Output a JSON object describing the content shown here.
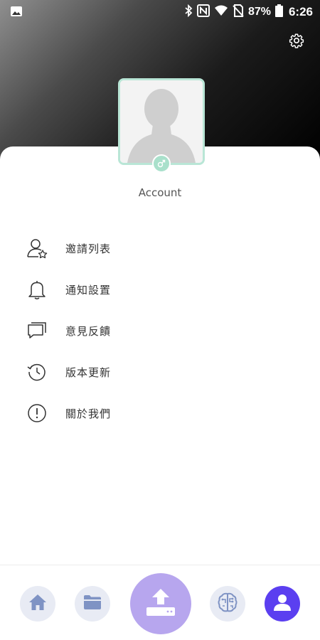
{
  "status_bar": {
    "battery_percent": "87%",
    "time": "6:26",
    "icons": [
      "image-icon",
      "bluetooth-icon",
      "nfc-icon",
      "wifi-icon",
      "no-sim-icon",
      "battery-icon"
    ]
  },
  "header": {
    "settings_icon": "gear-icon"
  },
  "profile": {
    "account_name": "Account",
    "gender_icon": "male-icon"
  },
  "menu": {
    "items": [
      {
        "label": "邀請列表",
        "icon": "user-invite-icon"
      },
      {
        "label": "通知設置",
        "icon": "bell-icon"
      },
      {
        "label": "意見反饋",
        "icon": "chat-icon"
      },
      {
        "label": "版本更新",
        "icon": "history-icon"
      },
      {
        "label": "關於我們",
        "icon": "info-icon"
      }
    ]
  },
  "bottom_nav": {
    "items": [
      {
        "icon": "home-icon",
        "active": false
      },
      {
        "icon": "folder-icon",
        "active": false
      },
      {
        "icon": "upload-icon",
        "active": false
      },
      {
        "icon": "brain-icon",
        "active": false
      },
      {
        "icon": "person-icon",
        "active": true
      }
    ]
  },
  "colors": {
    "accent": "#5b3ff0",
    "upload_bg": "#b7a6ee",
    "nav_inactive_bg": "#e8ebf4",
    "nav_inactive_icon": "#7f93c4",
    "avatar_border": "#b9e6d6",
    "gender_badge": "#a9e0cb"
  }
}
